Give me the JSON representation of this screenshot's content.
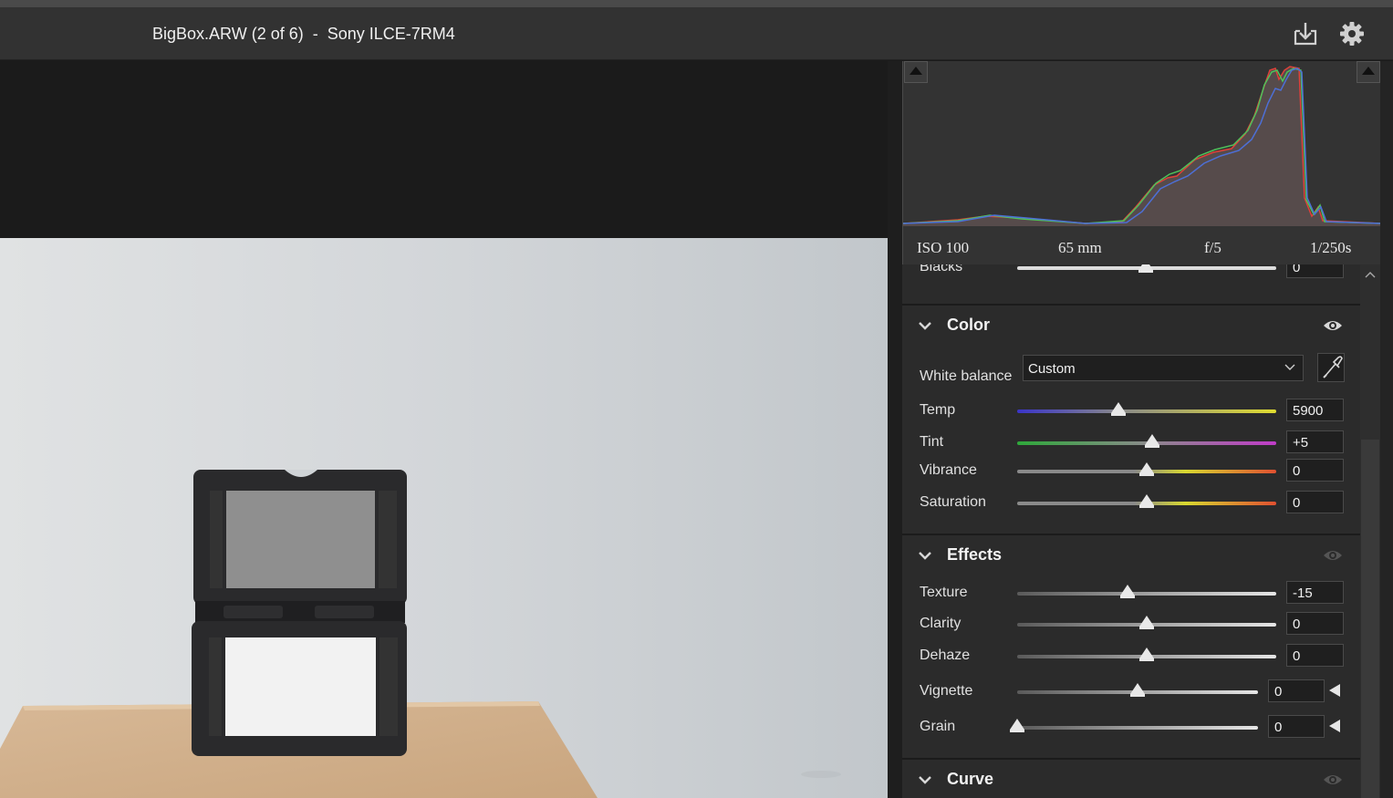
{
  "titlebar": {
    "title": "BigBox.ARW (2 of 6)  -  Sony ILCE-7RM4",
    "icons": [
      "download-icon",
      "gear-icon"
    ]
  },
  "histogram": {
    "exif": {
      "iso": "ISO 100",
      "focal": "65 mm",
      "aperture": "f/5",
      "shutter": "1/250s"
    }
  },
  "light_partial": {
    "label": "Blacks",
    "value": "0"
  },
  "color": {
    "title": "Color",
    "white_balance_label": "White balance",
    "white_balance_value": "Custom",
    "sliders": [
      {
        "label": "Temp",
        "value": "5900",
        "position": 0.39
      },
      {
        "label": "Tint",
        "value": "+5",
        "position": 0.52
      },
      {
        "label": "Vibrance",
        "value": "0",
        "position": 0.5
      },
      {
        "label": "Saturation",
        "value": "0",
        "position": 0.5
      }
    ]
  },
  "effects": {
    "title": "Effects",
    "sliders": [
      {
        "label": "Texture",
        "value": "-15",
        "position": 0.425
      },
      {
        "label": "Clarity",
        "value": "0",
        "position": 0.5
      },
      {
        "label": "Dehaze",
        "value": "0",
        "position": 0.5
      },
      {
        "label": "Vignette",
        "value": "0",
        "position": 0.5
      },
      {
        "label": "Grain",
        "value": "0",
        "position": 0.0
      }
    ]
  },
  "curve": {
    "title": "Curve"
  },
  "colors": {
    "panel_bg": "#2b2b2b",
    "titlebar_bg": "#323232",
    "histogram_red": "#e0413a",
    "histogram_green": "#4ec25a",
    "histogram_blue": "#4d6fd6"
  }
}
